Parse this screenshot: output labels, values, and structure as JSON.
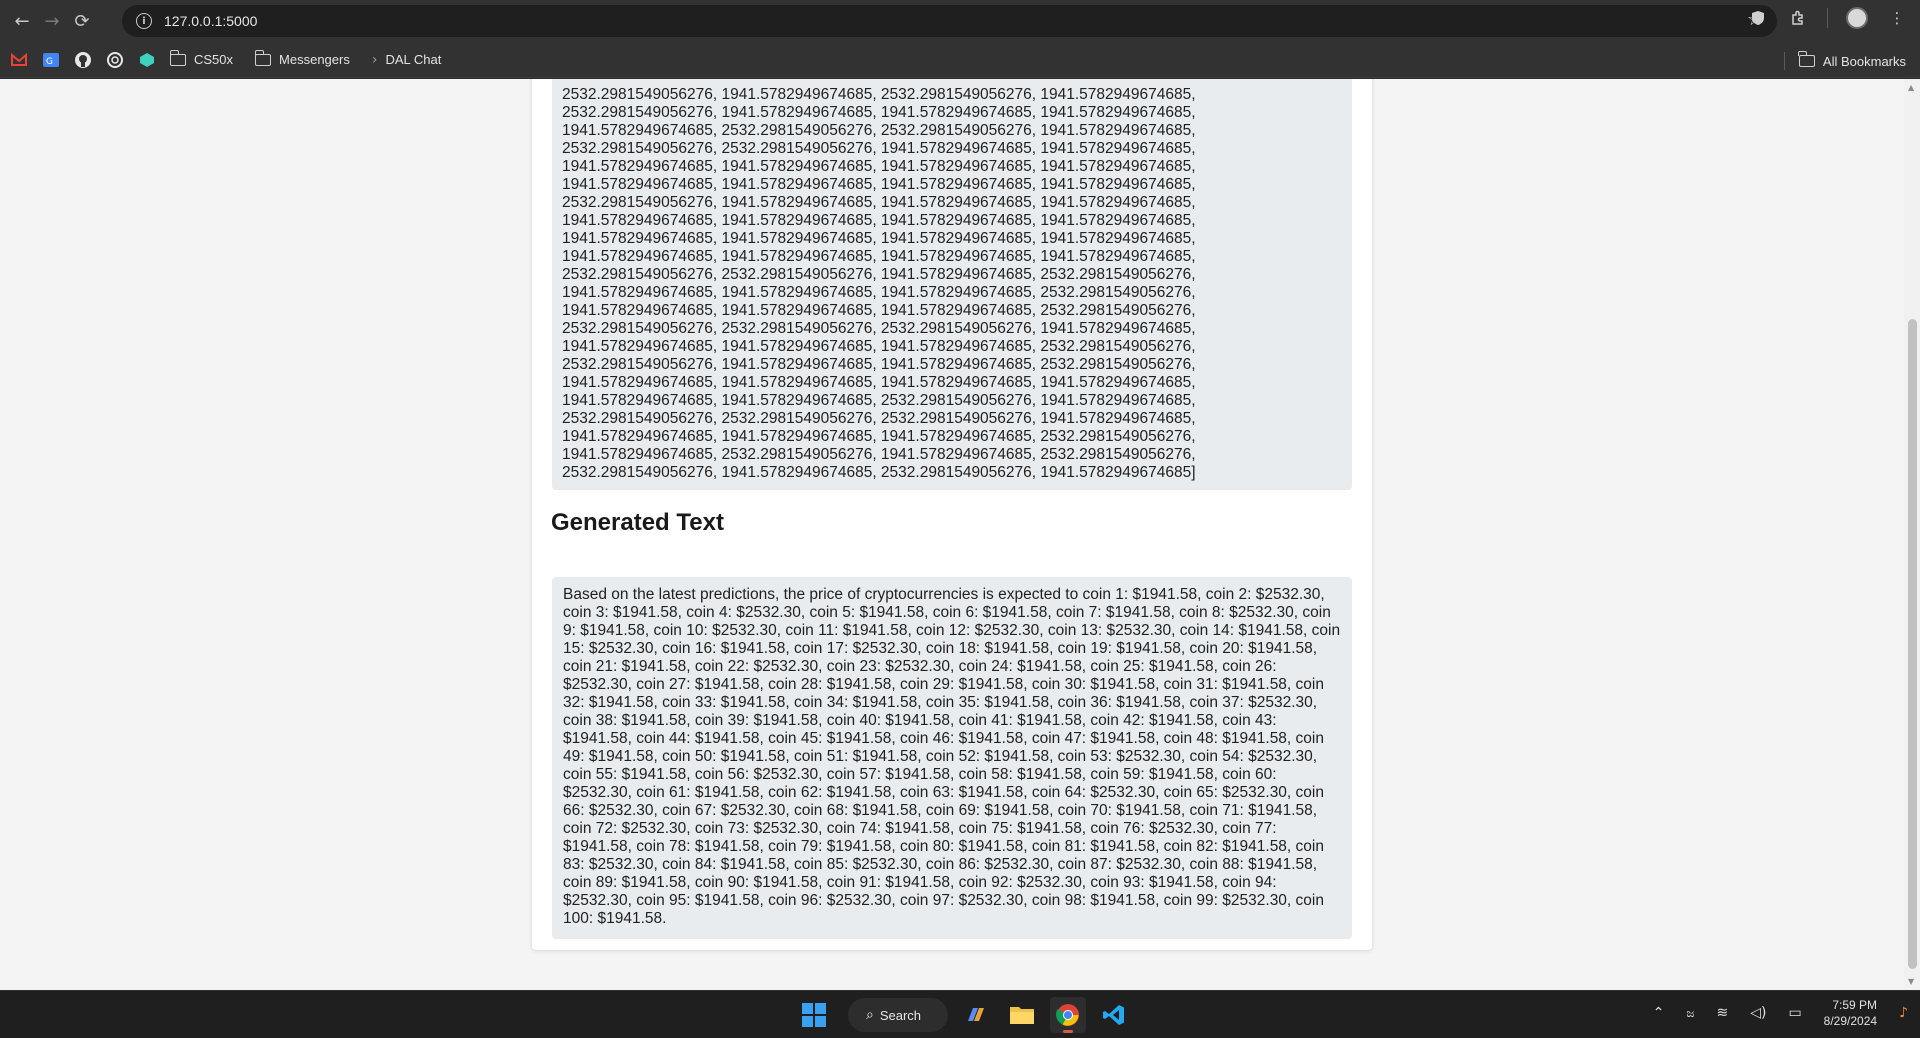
{
  "browser": {
    "url": "127.0.0.1:5000",
    "nav": {
      "back": "←",
      "forward": "→",
      "reload": "⟳"
    }
  },
  "bookmarks": {
    "items": [
      {
        "label": "CS50x",
        "type": "folder"
      },
      {
        "label": "Messengers",
        "type": "folder"
      },
      {
        "label": "DAL Chat",
        "type": "link"
      }
    ],
    "all_bookmarks": "All Bookmarks",
    "favicons": [
      "gmail-icon",
      "google-translate-icon",
      "github-icon",
      "openai-icon",
      "codepen-icon"
    ]
  },
  "predictions": {
    "lines": [
      "2532.2981549056276, 1941.5782949674685, 2532.2981549056276, 1941.5782949674685,",
      "2532.2981549056276, 1941.5782949674685, 1941.5782949674685, 1941.5782949674685,",
      "1941.5782949674685, 2532.2981549056276, 2532.2981549056276, 1941.5782949674685,",
      "2532.2981549056276, 2532.2981549056276, 1941.5782949674685, 1941.5782949674685,",
      "1941.5782949674685, 1941.5782949674685, 1941.5782949674685, 1941.5782949674685,",
      "1941.5782949674685, 1941.5782949674685, 1941.5782949674685, 1941.5782949674685,",
      "2532.2981549056276, 1941.5782949674685, 1941.5782949674685, 1941.5782949674685,",
      "1941.5782949674685, 1941.5782949674685, 1941.5782949674685, 1941.5782949674685,",
      "1941.5782949674685, 1941.5782949674685, 1941.5782949674685, 1941.5782949674685,",
      "1941.5782949674685, 1941.5782949674685, 1941.5782949674685, 1941.5782949674685,",
      "2532.2981549056276, 2532.2981549056276, 1941.5782949674685, 2532.2981549056276,",
      "1941.5782949674685, 1941.5782949674685, 1941.5782949674685, 2532.2981549056276,",
      "1941.5782949674685, 1941.5782949674685, 1941.5782949674685, 2532.2981549056276,",
      "2532.2981549056276, 2532.2981549056276, 2532.2981549056276, 1941.5782949674685,",
      "1941.5782949674685, 1941.5782949674685, 1941.5782949674685, 2532.2981549056276,",
      "2532.2981549056276, 1941.5782949674685, 1941.5782949674685, 2532.2981549056276,",
      "1941.5782949674685, 1941.5782949674685, 1941.5782949674685, 1941.5782949674685,",
      "1941.5782949674685, 1941.5782949674685, 2532.2981549056276, 1941.5782949674685,",
      "2532.2981549056276, 2532.2981549056276, 2532.2981549056276, 1941.5782949674685,",
      "1941.5782949674685, 1941.5782949674685, 1941.5782949674685, 2532.2981549056276,",
      "1941.5782949674685, 2532.2981549056276, 1941.5782949674685, 2532.2981549056276,",
      "2532.2981549056276, 1941.5782949674685, 2532.2981549056276, 1941.5782949674685]"
    ]
  },
  "generated": {
    "title": "Generated Text",
    "text": "Based on the latest predictions, the price of cryptocurrencies is expected to coin 1: $1941.58, coin 2: $2532.30, coin 3: $1941.58, coin 4: $2532.30, coin 5: $1941.58, coin 6: $1941.58, coin 7: $1941.58, coin 8: $2532.30, coin 9: $1941.58, coin 10: $2532.30, coin 11: $1941.58, coin 12: $2532.30, coin 13: $2532.30, coin 14: $1941.58, coin 15: $2532.30, coin 16: $1941.58, coin 17: $2532.30, coin 18: $1941.58, coin 19: $1941.58, coin 20: $1941.58, coin 21: $1941.58, coin 22: $2532.30, coin 23: $2532.30, coin 24: $1941.58, coin 25: $1941.58, coin 26: $2532.30, coin 27: $1941.58, coin 28: $1941.58, coin 29: $1941.58, coin 30: $1941.58, coin 31: $1941.58, coin 32: $1941.58, coin 33: $1941.58, coin 34: $1941.58, coin 35: $1941.58, coin 36: $1941.58, coin 37: $2532.30, coin 38: $1941.58, coin 39: $1941.58, coin 40: $1941.58, coin 41: $1941.58, coin 42: $1941.58, coin 43: $1941.58, coin 44: $1941.58, coin 45: $1941.58, coin 46: $1941.58, coin 47: $1941.58, coin 48: $1941.58, coin 49: $1941.58, coin 50: $1941.58, coin 51: $1941.58, coin 52: $1941.58, coin 53: $2532.30, coin 54: $2532.30, coin 55: $1941.58, coin 56: $2532.30, coin 57: $1941.58, coin 58: $1941.58, coin 59: $1941.58, coin 60: $2532.30, coin 61: $1941.58, coin 62: $1941.58, coin 63: $1941.58, coin 64: $2532.30, coin 65: $2532.30, coin 66: $2532.30, coin 67: $2532.30, coin 68: $1941.58, coin 69: $1941.58, coin 70: $1941.58, coin 71: $1941.58, coin 72: $2532.30, coin 73: $2532.30, coin 74: $1941.58, coin 75: $1941.58, coin 76: $2532.30, coin 77: $1941.58, coin 78: $1941.58, coin 79: $1941.58, coin 80: $1941.58, coin 81: $1941.58, coin 82: $1941.58, coin 83: $2532.30, coin 84: $1941.58, coin 85: $2532.30, coin 86: $2532.30, coin 87: $2532.30, coin 88: $1941.58, coin 89: $1941.58, coin 90: $1941.58, coin 91: $1941.58, coin 92: $2532.30, coin 93: $1941.58, coin 94: $2532.30, coin 95: $1941.58, coin 96: $2532.30, coin 97: $2532.30, coin 98: $1941.58, coin 99: $2532.30, coin 100: $1941.58."
  },
  "taskbar": {
    "search_label": "Search",
    "apps": [
      "copilot-icon",
      "file-explorer-icon",
      "chrome-icon",
      "vscode-icon"
    ],
    "time": "7:59 PM",
    "date": "8/29/2024"
  }
}
